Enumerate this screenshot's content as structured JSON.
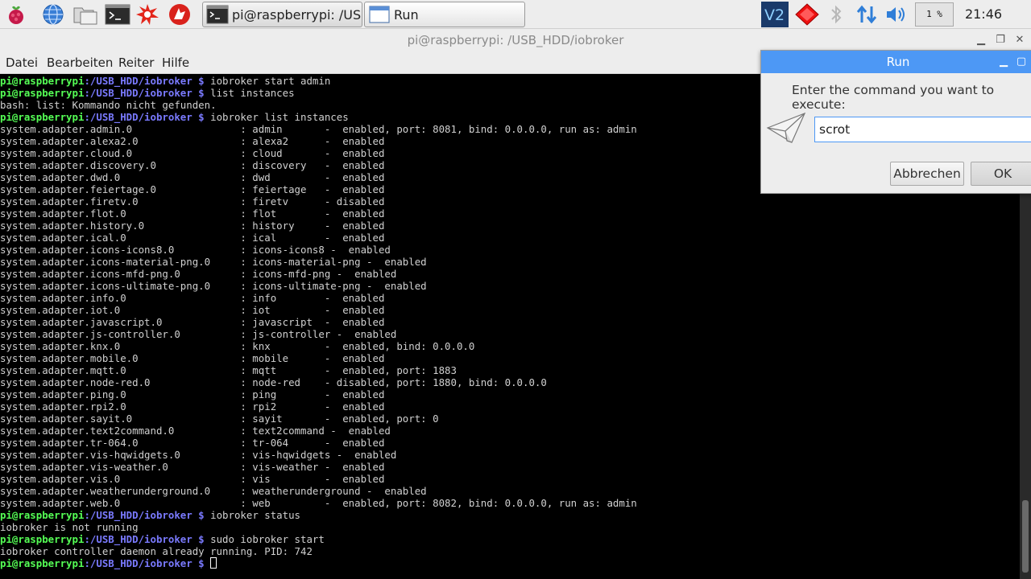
{
  "taskbar": {
    "tasks": [
      {
        "label": "pi@raspberrypi: /USB_HDD/iobroker"
      },
      {
        "label": "Run"
      }
    ],
    "cpu_usage": "1 %",
    "clock": "21:46"
  },
  "terminal": {
    "title": "pi@raspberrypi: /USB_HDD/iobroker",
    "menu": [
      "Datei",
      "Bearbeiten",
      "Reiter",
      "Hilfe"
    ],
    "prompt": {
      "user": "pi@raspberrypi",
      "path": ":/USB_HDD/iobroker",
      "symbol": " $ "
    },
    "lines": [
      {
        "prompt": true,
        "text": "iobroker start admin"
      },
      {
        "prompt": true,
        "text": "list instances"
      },
      {
        "prompt": false,
        "text": "bash: list: Kommando nicht gefunden."
      },
      {
        "prompt": true,
        "text": "iobroker list instances"
      },
      {
        "prompt": false,
        "text": "system.adapter.admin.0                  : admin       -  enabled, port: 8081, bind: 0.0.0.0, run as: admin"
      },
      {
        "prompt": false,
        "text": "system.adapter.alexa2.0                 : alexa2      -  enabled"
      },
      {
        "prompt": false,
        "text": "system.adapter.cloud.0                  : cloud       -  enabled"
      },
      {
        "prompt": false,
        "text": "system.adapter.discovery.0              : discovery   -  enabled"
      },
      {
        "prompt": false,
        "text": "system.adapter.dwd.0                    : dwd         -  enabled"
      },
      {
        "prompt": false,
        "text": "system.adapter.feiertage.0              : feiertage   -  enabled"
      },
      {
        "prompt": false,
        "text": "system.adapter.firetv.0                 : firetv      - disabled"
      },
      {
        "prompt": false,
        "text": "system.adapter.flot.0                   : flot        -  enabled"
      },
      {
        "prompt": false,
        "text": "system.adapter.history.0                : history     -  enabled"
      },
      {
        "prompt": false,
        "text": "system.adapter.ical.0                   : ical        -  enabled"
      },
      {
        "prompt": false,
        "text": "system.adapter.icons-icons8.0           : icons-icons8 -  enabled"
      },
      {
        "prompt": false,
        "text": "system.adapter.icons-material-png.0     : icons-material-png -  enabled"
      },
      {
        "prompt": false,
        "text": "system.adapter.icons-mfd-png.0          : icons-mfd-png -  enabled"
      },
      {
        "prompt": false,
        "text": "system.adapter.icons-ultimate-png.0     : icons-ultimate-png -  enabled"
      },
      {
        "prompt": false,
        "text": "system.adapter.info.0                   : info        -  enabled"
      },
      {
        "prompt": false,
        "text": "system.adapter.iot.0                    : iot         -  enabled"
      },
      {
        "prompt": false,
        "text": "system.adapter.javascript.0             : javascript  -  enabled"
      },
      {
        "prompt": false,
        "text": "system.adapter.js-controller.0          : js-controller -  enabled"
      },
      {
        "prompt": false,
        "text": "system.adapter.knx.0                    : knx         -  enabled, bind: 0.0.0.0"
      },
      {
        "prompt": false,
        "text": "system.adapter.mobile.0                 : mobile      -  enabled"
      },
      {
        "prompt": false,
        "text": "system.adapter.mqtt.0                   : mqtt        -  enabled, port: 1883"
      },
      {
        "prompt": false,
        "text": "system.adapter.node-red.0               : node-red    - disabled, port: 1880, bind: 0.0.0.0"
      },
      {
        "prompt": false,
        "text": "system.adapter.ping.0                   : ping        -  enabled"
      },
      {
        "prompt": false,
        "text": "system.adapter.rpi2.0                   : rpi2        -  enabled"
      },
      {
        "prompt": false,
        "text": "system.adapter.sayit.0                  : sayit       -  enabled, port: 0"
      },
      {
        "prompt": false,
        "text": "system.adapter.text2command.0           : text2command -  enabled"
      },
      {
        "prompt": false,
        "text": "system.adapter.tr-064.0                 : tr-064      -  enabled"
      },
      {
        "prompt": false,
        "text": "system.adapter.vis-hqwidgets.0          : vis-hqwidgets -  enabled"
      },
      {
        "prompt": false,
        "text": "system.adapter.vis-weather.0            : vis-weather -  enabled"
      },
      {
        "prompt": false,
        "text": "system.adapter.vis.0                    : vis         -  enabled"
      },
      {
        "prompt": false,
        "text": "system.adapter.weatherunderground.0     : weatherunderground -  enabled"
      },
      {
        "prompt": false,
        "text": "system.adapter.web.0                    : web         -  enabled, port: 8082, bind: 0.0.0.0, run as: admin"
      },
      {
        "prompt": true,
        "text": "iobroker status"
      },
      {
        "prompt": false,
        "text": "iobroker is not running"
      },
      {
        "prompt": true,
        "text": "sudo iobroker start"
      },
      {
        "prompt": false,
        "text": "iobroker controller daemon already running. PID: 742"
      },
      {
        "prompt": true,
        "text": "",
        "cursor": true
      }
    ]
  },
  "run_dialog": {
    "title": "Run",
    "prompt": "Enter the command you want to execute:",
    "input_value": "scrot",
    "cancel_label": "Abbrechen",
    "ok_label": "OK"
  },
  "colors": {
    "prompt_user": "#55ff55",
    "prompt_path": "#7a7aff",
    "dialog_title": "#4d98f5"
  }
}
